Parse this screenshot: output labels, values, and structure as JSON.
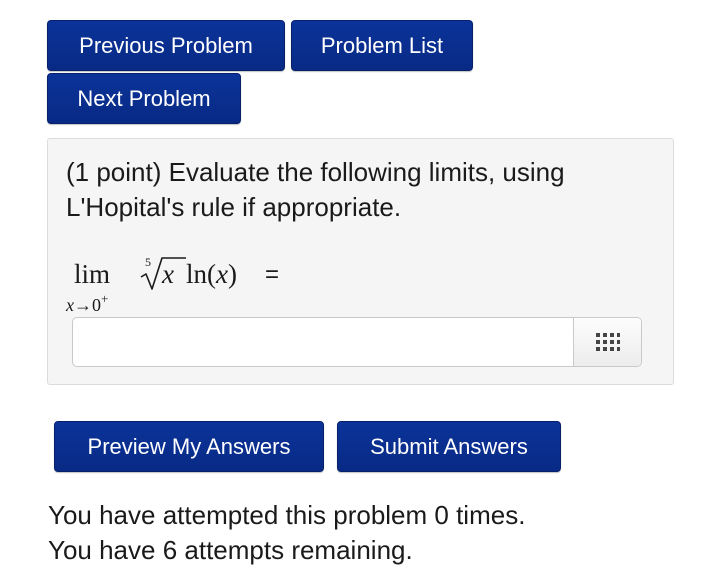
{
  "nav": {
    "previous_label": "Previous Problem",
    "list_label": "Problem List",
    "next_label": "Next Problem"
  },
  "problem": {
    "prompt": "(1 point) Evaluate the following limits, using L'Hopital's rule if appropriate.",
    "math": {
      "lim": "lim",
      "sub_var": "x",
      "sub_arrow": "→",
      "sub_target": "0",
      "sub_sup": "+",
      "root_index": "5",
      "radicand": "x",
      "ln_func": "ln",
      "ln_open": "(",
      "ln_arg": "x",
      "ln_close": ")",
      "equals": "="
    },
    "answer": {
      "value": "",
      "placeholder": ""
    },
    "keyboard_icon": "keypad-grid-icon"
  },
  "actions": {
    "preview_label": "Preview My Answers",
    "submit_label": "Submit Answers"
  },
  "status": {
    "attempted": "You have attempted this problem 0 times.",
    "remaining": "You have 6 attempts remaining."
  },
  "colors": {
    "button_bg": "#0a2d8f",
    "button_text": "#ffffff",
    "problem_bg": "#f5f5f5"
  }
}
